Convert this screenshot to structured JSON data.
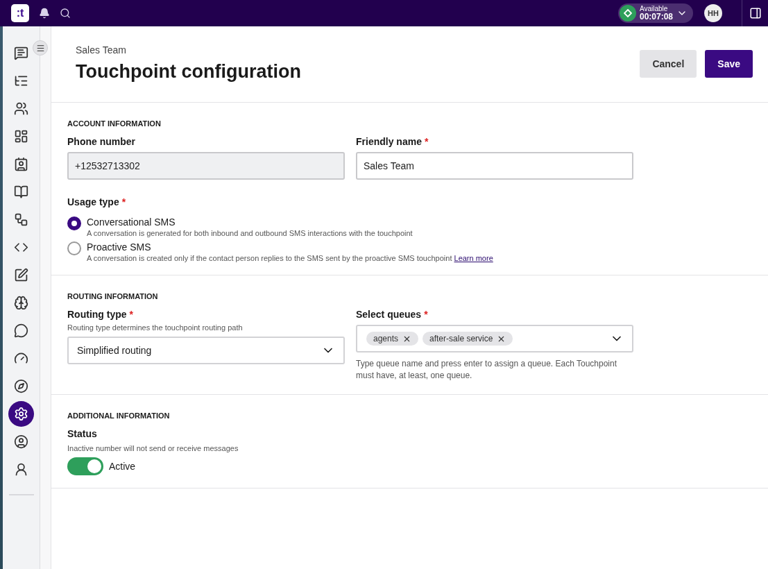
{
  "topbar": {
    "logo": ":t",
    "agent_status": {
      "label": "Available",
      "timer": "00:07:08"
    },
    "avatar": "HH"
  },
  "sidebar": {
    "items": [
      {
        "selected": false
      },
      {
        "selected": false
      },
      {
        "selected": false
      },
      {
        "selected": false
      },
      {
        "selected": false
      },
      {
        "selected": false
      },
      {
        "selected": false
      },
      {
        "selected": false
      },
      {
        "selected": false
      },
      {
        "selected": false
      },
      {
        "selected": false
      },
      {
        "selected": false
      },
      {
        "selected": false
      },
      {
        "selected": true
      },
      {
        "selected": false
      },
      {
        "selected": false
      }
    ]
  },
  "header": {
    "breadcrumb": "Sales Team",
    "title": "Touchpoint configuration",
    "buttons": [
      {
        "label": "Cancel",
        "kind": "secondary"
      },
      {
        "label": "Save",
        "kind": "primary"
      }
    ]
  },
  "sections": [
    {
      "title": "ACCOUNT INFORMATION",
      "fields": [
        {
          "kind": "text",
          "label": "Phone number",
          "value": "+12532713302",
          "disabled": true
        },
        {
          "kind": "text",
          "label": "Friendly name",
          "required_mark": "*",
          "value": "Sales Team",
          "disabled": false
        }
      ],
      "radio_group": {
        "label": "Usage type",
        "required_mark": "*",
        "options": [
          {
            "label": "Conversational SMS",
            "description": "A conversation is generated for both inbound and outbound SMS interactions with the touchpoint",
            "selected": true
          },
          {
            "label": "Proactive SMS",
            "description": "A conversation is created only if the contact person replies to the SMS sent by the proactive SMS touchpoint",
            "link": "Learn more",
            "selected": false
          }
        ]
      }
    },
    {
      "title": "ROUTING INFORMATION",
      "fields": [
        {
          "kind": "select",
          "label": "Routing type",
          "required_mark": "*",
          "hint": "Routing type determines the touchpoint routing path",
          "value": "Simplified routing"
        },
        {
          "kind": "multiselect",
          "label": "Select queues",
          "required_mark": "*",
          "chips": [
            "agents",
            "after-sale service"
          ],
          "help": "Type queue name and press enter to assign a queue. Each Touchpoint must have, at least, one queue."
        }
      ]
    },
    {
      "title": "ADDITIONAL INFORMATION",
      "status": {
        "label": "Status",
        "hint": "Inactive number will not send or receive messages",
        "on": true,
        "toggle_label": "Active"
      }
    }
  ]
}
